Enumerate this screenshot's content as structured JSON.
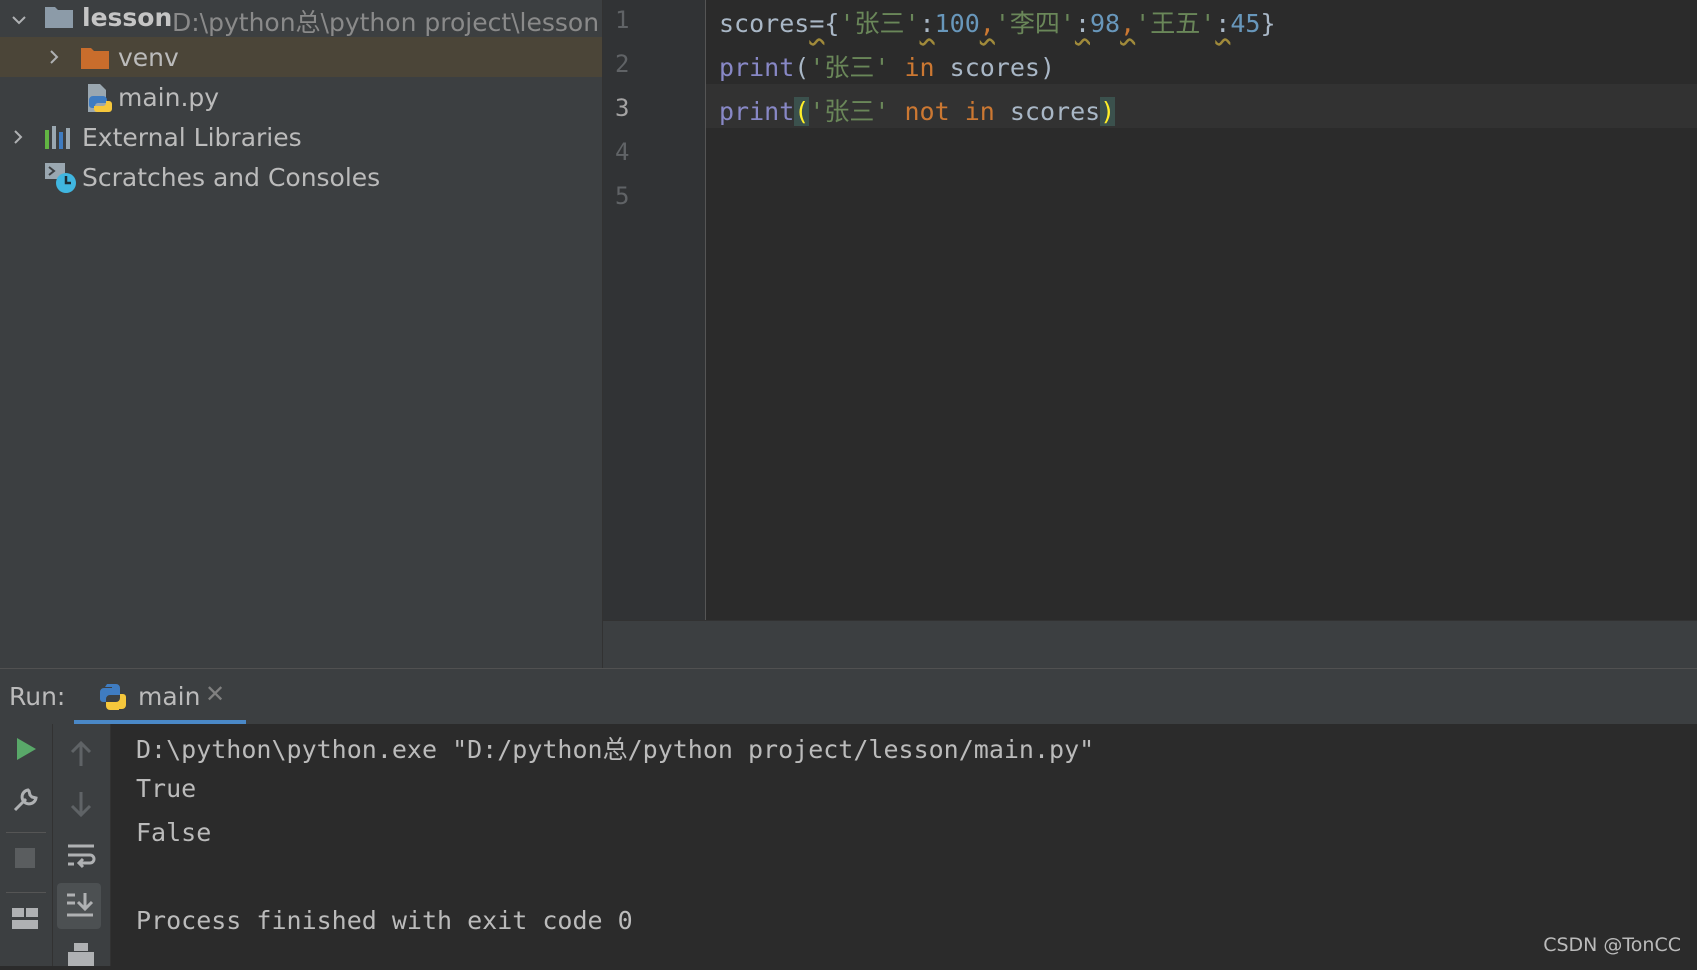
{
  "project_tree": {
    "root": {
      "name": "lesson",
      "path": "D:\\python总\\python project\\lesson"
    },
    "items": [
      {
        "label": "venv",
        "icon": "folder-icon",
        "color": "#c96d2c"
      },
      {
        "label": "main.py",
        "icon": "python-file-icon"
      },
      {
        "label": "External Libraries",
        "icon": "library-icon"
      },
      {
        "label": "Scratches and Consoles",
        "icon": "scratches-icon"
      }
    ]
  },
  "editor": {
    "line_numbers": [
      "1",
      "2",
      "3",
      "4",
      "5"
    ],
    "current_line": 3,
    "lines": [
      {
        "tokens": [
          {
            "t": "scores",
            "c": "id"
          },
          {
            "t": "=",
            "c": "id",
            "w": true
          },
          {
            "t": "{",
            "c": "id"
          },
          {
            "t": "'张三'",
            "c": "str"
          },
          {
            "t": ":",
            "c": "id",
            "w": true
          },
          {
            "t": "100",
            "c": "num"
          },
          {
            "t": ",",
            "c": "kw",
            "w": true
          },
          {
            "t": "'李四'",
            "c": "str"
          },
          {
            "t": ":",
            "c": "id",
            "w": true
          },
          {
            "t": "98",
            "c": "num"
          },
          {
            "t": ",",
            "c": "kw",
            "w": true
          },
          {
            "t": "'王五'",
            "c": "str"
          },
          {
            "t": ":",
            "c": "id",
            "w": true
          },
          {
            "t": "45",
            "c": "num"
          },
          {
            "t": "}",
            "c": "id"
          }
        ]
      },
      {
        "tokens": [
          {
            "t": "print",
            "c": "fn"
          },
          {
            "t": "(",
            "c": "id"
          },
          {
            "t": "'张三'",
            "c": "str"
          },
          {
            "t": " in ",
            "c": "kw"
          },
          {
            "t": "scores",
            "c": "id"
          },
          {
            "t": ")",
            "c": "id"
          }
        ]
      },
      {
        "tokens": [
          {
            "t": "print",
            "c": "fn"
          },
          {
            "t": "(",
            "c": "br"
          },
          {
            "t": "'张三'",
            "c": "str"
          },
          {
            "t": " not in ",
            "c": "kw"
          },
          {
            "t": "scores",
            "c": "id"
          },
          {
            "t": ")",
            "c": "br"
          }
        ]
      }
    ]
  },
  "run": {
    "label": "Run:",
    "tab": "main",
    "output": [
      "D:\\python\\python.exe \"D:/python总/python project/lesson/main.py\"",
      "True",
      "False",
      "",
      "Process finished with exit code 0"
    ]
  },
  "watermark": "CSDN @TonCC",
  "colors": {
    "keyword": "#cc7832",
    "function": "#8888c6",
    "string": "#6a8759",
    "number": "#6897bb",
    "accent": "#4a88c7"
  }
}
